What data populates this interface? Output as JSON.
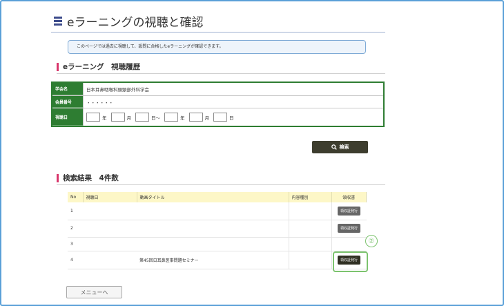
{
  "page": {
    "title": "eラーニングの視聴と確認",
    "notice": "このページでは過去に視聴して、設問に合格したeラーニングが確認できます。"
  },
  "section_history": {
    "title": "eラーニング　視聴履歴"
  },
  "form": {
    "society_label": "学会名",
    "society_value": "日本耳鼻咽喉科頭頸部外科学会",
    "member_label": "会員番号",
    "member_value": "・・・・・・",
    "date_label": "視聴日",
    "year_unit": "年",
    "month_unit": "月",
    "day_unit_tilde": "日～",
    "day_unit": "日"
  },
  "search": {
    "label": "検索",
    "icon": "search-icon"
  },
  "section_results": {
    "title": "検索結果　4件数"
  },
  "table": {
    "headers": {
      "no": "No",
      "date": "視聴日",
      "video_title": "動画タイトル",
      "content_type": "内容種別",
      "certificate": "領収書"
    },
    "rows": [
      {
        "no": "1",
        "date": "",
        "video_title": "",
        "content_type": "",
        "cert_label": "領収証発行"
      },
      {
        "no": "2",
        "date": "",
        "video_title": "",
        "content_type": "",
        "cert_label": "領収証発行"
      },
      {
        "no": "3",
        "date": "",
        "video_title": "",
        "content_type": "",
        "cert_label": ""
      },
      {
        "no": "4",
        "date": "",
        "video_title": "第45回日耳鼻医事問題セミナー",
        "content_type": "",
        "cert_label": "領収証発行"
      }
    ]
  },
  "callout": {
    "number": "②"
  },
  "menu_button": {
    "label": "メニューへ"
  },
  "colors": {
    "frame": "#5aa0d8",
    "form_green": "#2e7d32",
    "accent_pink": "#d9366c",
    "header_yellow": "#fdf7c7",
    "highlight_green": "#7cc36e"
  }
}
